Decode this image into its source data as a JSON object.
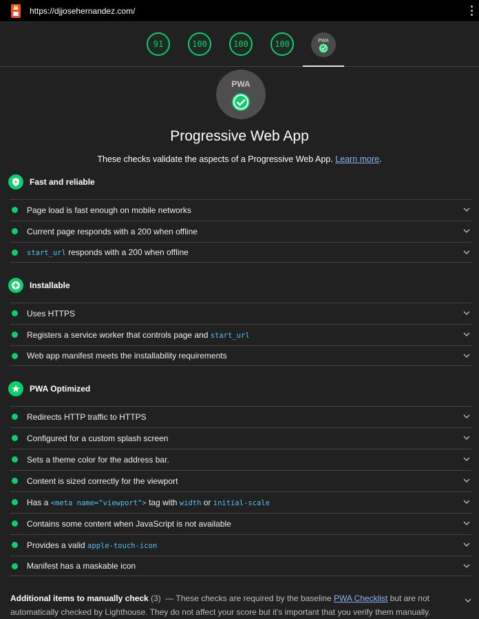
{
  "browser": {
    "url": "https://djjosehernandez.com/"
  },
  "gauges": {
    "scores": [
      "91",
      "100",
      "100",
      "100"
    ],
    "pwa_badge_label": "PWA"
  },
  "category": {
    "badge_label": "PWA",
    "title": "Progressive Web App",
    "description": "These checks validate the aspects of a Progressive Web App.",
    "learn_more": "Learn more",
    "period": "."
  },
  "groups": {
    "fast": {
      "title": "Fast and reliable",
      "audits": [
        {
          "label": "Page load is fast enough on mobile networks"
        },
        {
          "label": "Current page responds with a 200 when offline"
        },
        {
          "code": "start_url",
          "label": " responds with a 200 when offline"
        }
      ]
    },
    "installable": {
      "title": "Installable",
      "audits": [
        {
          "label": "Uses HTTPS"
        },
        {
          "label": "Registers a service worker that controls page and ",
          "code": "start_url"
        },
        {
          "label": "Web app manifest meets the installability requirements"
        }
      ]
    },
    "optimized": {
      "title": "PWA Optimized",
      "audits": [
        {
          "label": "Redirects HTTP traffic to HTTPS"
        },
        {
          "label": "Configured for a custom splash screen"
        },
        {
          "label": "Sets a theme color for the address bar."
        },
        {
          "label": "Content is sized correctly for the viewport"
        },
        {
          "t1": "Has a ",
          "c1": "<meta name=\"viewport\">",
          "t2": " tag with ",
          "c2": "width",
          "t3": " or ",
          "c3": "initial-scale"
        },
        {
          "label": "Contains some content when JavaScript is not available"
        },
        {
          "label": "Provides a valid ",
          "code": "apple-touch-icon"
        },
        {
          "label": "Manifest has a maskable icon"
        }
      ]
    }
  },
  "manual": {
    "title": "Additional items to manually check",
    "count": "(3)",
    "dash": "—",
    "text1": "These checks are required by the baseline",
    "link": "PWA Checklist",
    "text2": "but are not automatically checked by Lighthouse. They do not affect your score but it's important that you verify them manually."
  },
  "colors": {
    "pass": "#0cce6b",
    "background": "#212121",
    "link": "#8ab4f8",
    "code": "#4fc3f7"
  },
  "icons": [
    "lighthouse-logo-icon",
    "more-vert-icon",
    "shield-bolt-icon",
    "plus-circle-icon",
    "star-icon",
    "chevron-down-icon",
    "checkmark-icon"
  ]
}
